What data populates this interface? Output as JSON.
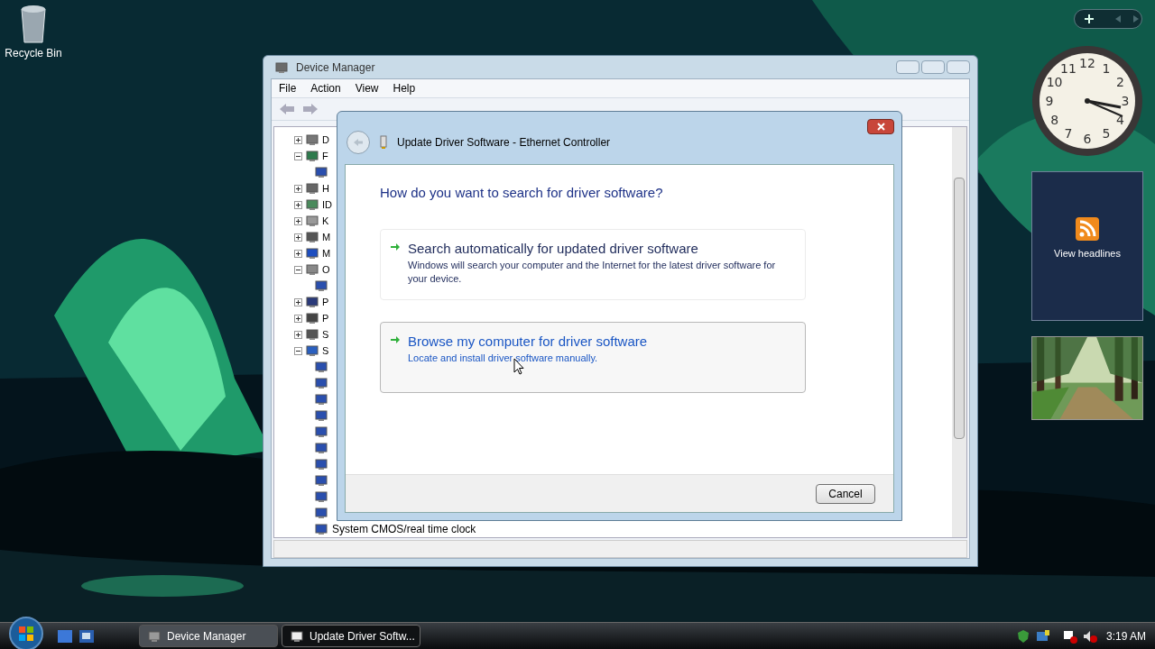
{
  "desktop_icons": [
    {
      "label": "Recycle Bin"
    }
  ],
  "device_manager": {
    "title": "Device Manager",
    "menu": [
      "File",
      "Action",
      "View",
      "Help"
    ],
    "tree": [
      {
        "label": "D",
        "expanded": false
      },
      {
        "label": "F",
        "expanded": true,
        "children": [
          {
            "kind": "device"
          }
        ]
      },
      {
        "label": "H",
        "expanded": false
      },
      {
        "label": "ID",
        "expanded": false
      },
      {
        "label": "K",
        "expanded": false
      },
      {
        "label": "M",
        "expanded": false
      },
      {
        "label": "M",
        "expanded": false
      },
      {
        "label": "O",
        "expanded": true,
        "children": [
          {
            "kind": "device"
          }
        ]
      },
      {
        "label": "P",
        "expanded": false
      },
      {
        "label": "P",
        "expanded": false
      },
      {
        "label": "S",
        "expanded": false
      },
      {
        "label": "S",
        "expanded": true,
        "children": [
          {
            "kind": "device"
          },
          {
            "kind": "device"
          },
          {
            "kind": "device"
          },
          {
            "kind": "device"
          },
          {
            "kind": "device"
          },
          {
            "kind": "device"
          },
          {
            "kind": "device"
          },
          {
            "kind": "device"
          },
          {
            "kind": "device"
          },
          {
            "kind": "device"
          },
          {
            "kind": "device",
            "label": "System CMOS/real time clock"
          }
        ]
      }
    ]
  },
  "dialog": {
    "title": "Update Driver Software - Ethernet Controller",
    "question": "How do you want to search for driver software?",
    "options": [
      {
        "title": "Search automatically for updated driver software",
        "description": "Windows will search your computer and the Internet for the latest driver software for your device.",
        "selected": false
      },
      {
        "title": "Browse my computer for driver software",
        "description": "Locate and install driver software manually.",
        "selected": true
      }
    ],
    "buttons": [
      "Cancel"
    ]
  },
  "gadgets": {
    "clock": {
      "numerals": [
        "12",
        "11",
        "1",
        "10",
        "2",
        "9",
        "3",
        "8",
        "4",
        "7",
        "5",
        "6"
      ]
    },
    "feed": {
      "label": "View headlines"
    }
  },
  "taskbar": {
    "buttons": [
      {
        "label": "Device Manager",
        "selected": false
      },
      {
        "label": "Update Driver Softw...",
        "selected": true
      }
    ],
    "time": "3:19 AM"
  }
}
